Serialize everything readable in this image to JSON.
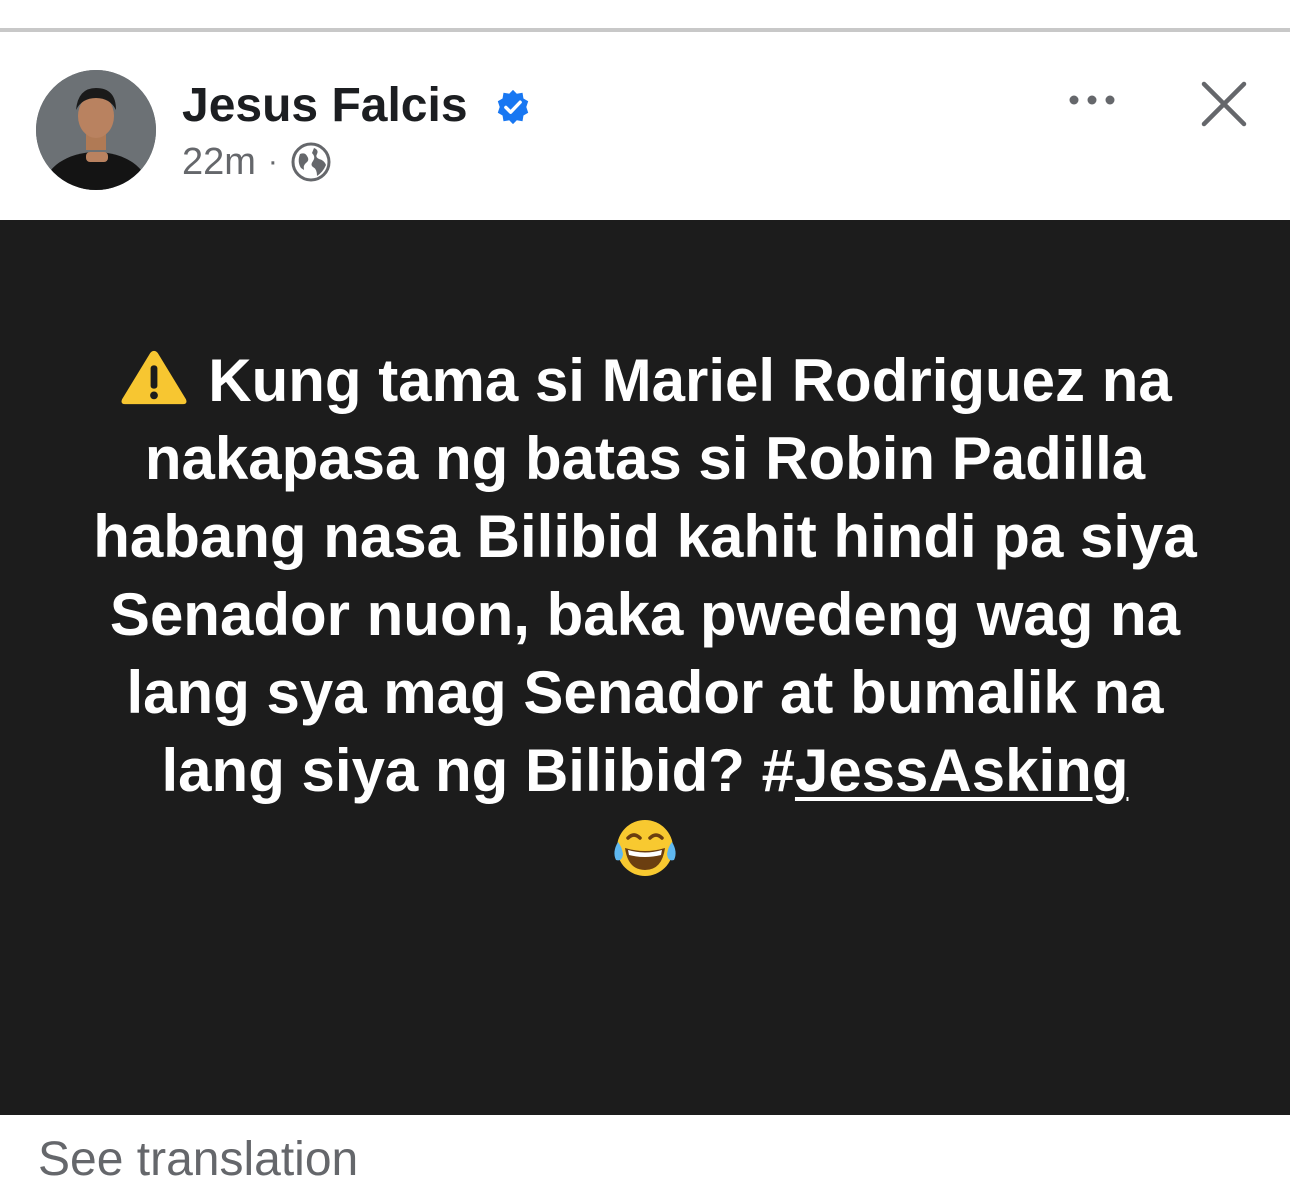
{
  "post": {
    "author_name": "Jesus Falcis",
    "timestamp": "22m",
    "separator": "·",
    "audience_icon": "globe-icon",
    "verified_icon": "verified-badge-icon",
    "more_icon": "more-options-icon",
    "close_icon": "close-icon",
    "body_lead": "Kung tama si Mariel Rodriguez na nakapasa ng batas si Robin Padilla habang nasa Bilibid kahit hindi pa siya Senador nuon, baka pwedeng wag na lang sya mag Senador at bumalik na lang siya ng Bilibid? #",
    "hashtag": "JessAsking",
    "lead_icon": "warning-icon",
    "trailing_emoji": "face-with-tears-of-joy-icon",
    "background_color": "#1c1c1c",
    "text_color": "#ffffff"
  },
  "footer": {
    "see_translation": "See translation"
  },
  "colors": {
    "verified_blue": "#1877f2",
    "secondary_text": "#65676b",
    "primary_text": "#1c1e21",
    "warning_yellow": "#f7c631"
  }
}
